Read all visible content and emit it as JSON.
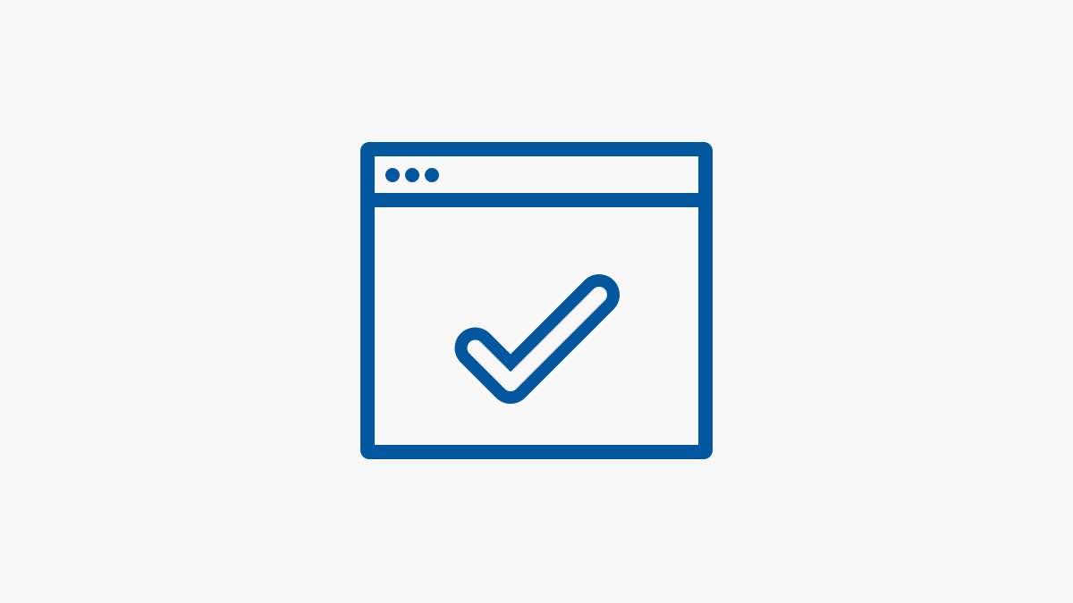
{
  "canvas": {
    "background_color": "#f8f8f8"
  },
  "icon": {
    "name": "browser-window-checkmark-icon",
    "color": "#02579e",
    "parts": {
      "window": "browser-window-icon",
      "dots": "window-control-dots-icon",
      "check": "checkmark-icon"
    }
  }
}
